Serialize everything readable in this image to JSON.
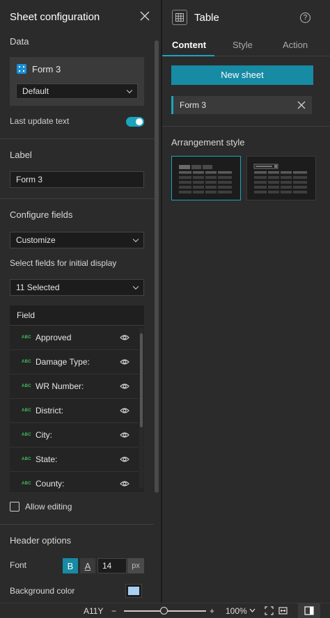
{
  "left": {
    "title": "Sheet configuration",
    "data_section": {
      "label": "Data",
      "source_name": "Form 3",
      "view_select": "Default",
      "last_update_label": "Last update text",
      "last_update_on": true
    },
    "label_section": {
      "label": "Label",
      "value": "Form 3"
    },
    "configure_fields": {
      "label": "Configure fields",
      "mode_select": "Customize",
      "initial_display_label": "Select fields for initial display",
      "selected_count": "11 Selected",
      "table_header": "Field",
      "type_badge": "ABC",
      "fields": [
        "Approved",
        "Damage Type:",
        "WR Number:",
        "District:",
        "City:",
        "State:",
        "County:"
      ]
    },
    "allow_editing_label": "Allow editing",
    "header_options": {
      "label": "Header options",
      "font_label": "Font",
      "bold_label": "B",
      "color_label": "A",
      "font_size": "14",
      "unit": "px",
      "background_label": "Background color",
      "background_color": "#a9cff2"
    }
  },
  "right": {
    "title": "Table",
    "help_label": "?",
    "tabs": [
      "Content",
      "Style",
      "Action"
    ],
    "new_sheet_label": "New sheet",
    "sheet_item": "Form 3",
    "arrangement_label": "Arrangement style"
  },
  "statusbar": {
    "element_id": "A11Y",
    "zoom": "100%"
  },
  "colors": {
    "accent": "#1aa5bc",
    "button": "#168ba3"
  }
}
